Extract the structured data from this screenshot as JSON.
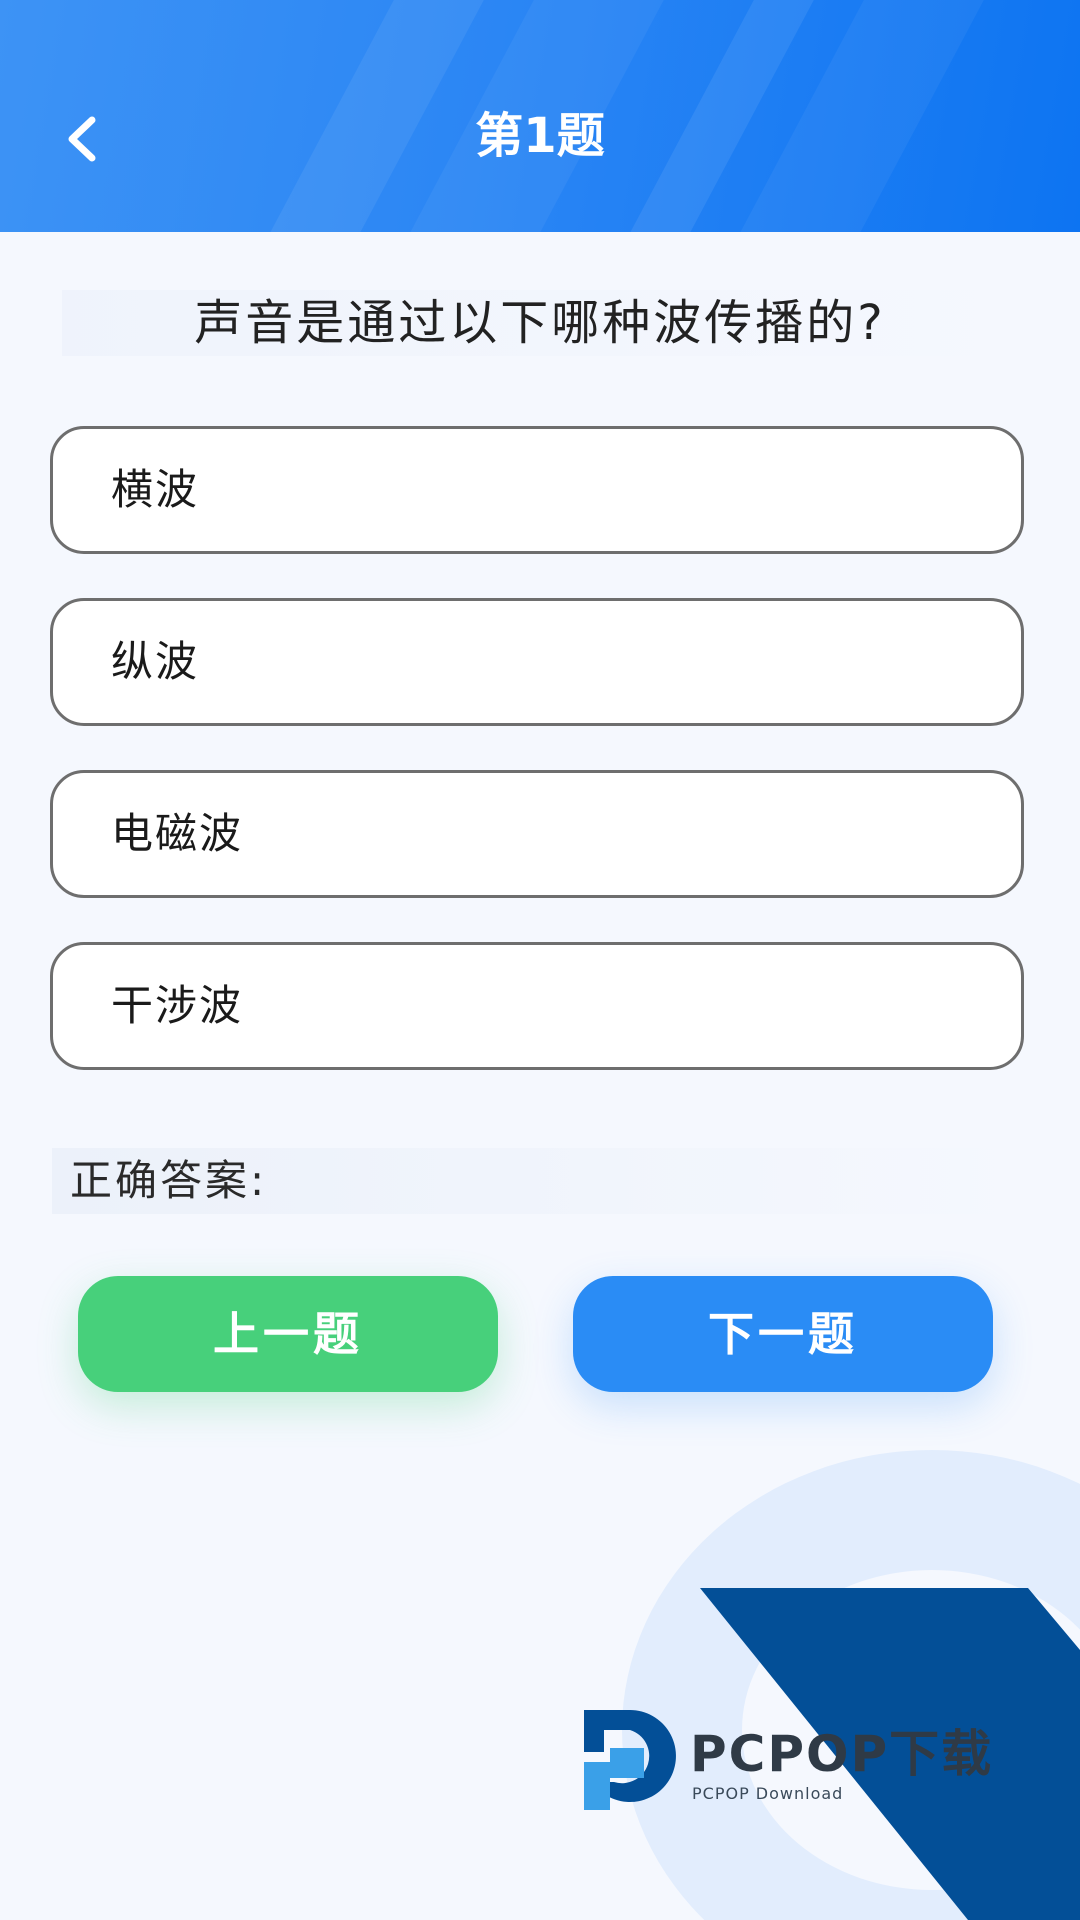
{
  "header": {
    "title": "第1题",
    "back_icon": "chevron-left-icon"
  },
  "question": {
    "text": "声音是通过以下哪种波传播的?"
  },
  "options": [
    {
      "label": "横波"
    },
    {
      "label": "纵波"
    },
    {
      "label": "电磁波"
    },
    {
      "label": "干涉波"
    }
  ],
  "answer": {
    "label": "正确答案:",
    "value": ""
  },
  "nav": {
    "prev_label": "上一题",
    "next_label": "下一题"
  },
  "watermark": {
    "brand": "PCPOP下载",
    "sub": "PCPOP Download"
  },
  "colors": {
    "header_gradient_start": "#3d93f5",
    "header_gradient_end": "#0d74f2",
    "prev_button": "#47d07b",
    "next_button": "#2a8cf5",
    "deco_dark_blue": "#034f97",
    "page_background": "#f5f8fe"
  }
}
